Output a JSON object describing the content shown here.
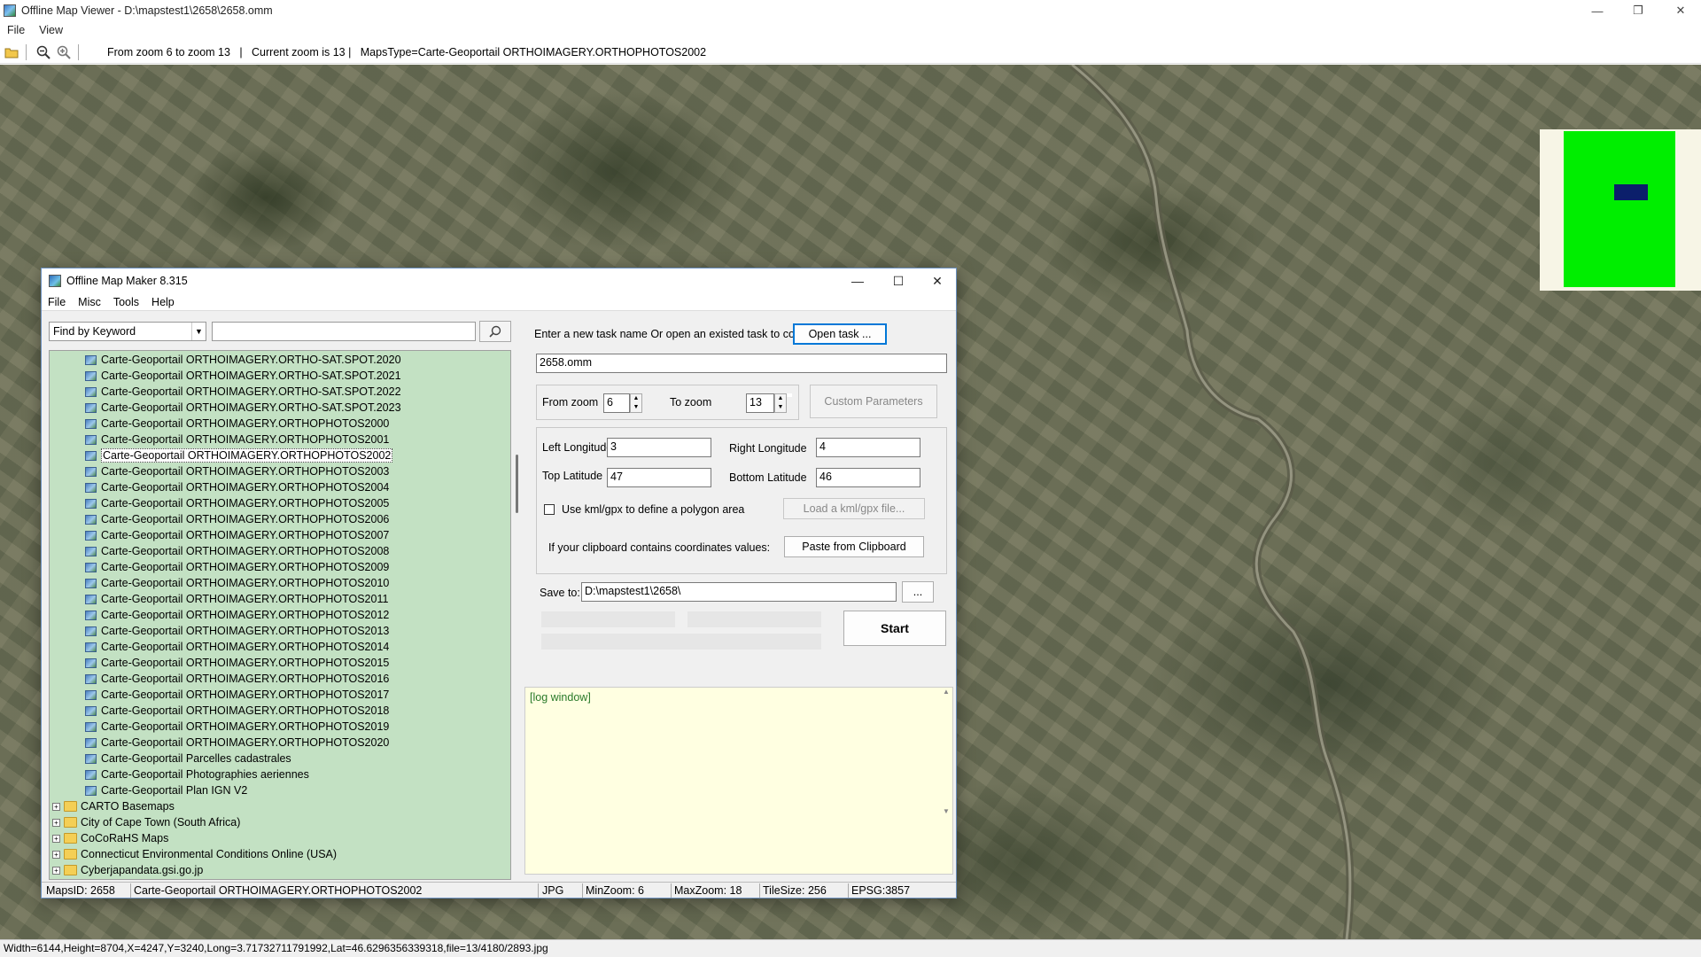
{
  "outer": {
    "title": "Offline Map Viewer - D:\\mapstest1\\2658\\2658.omm",
    "menu": [
      "File",
      "View"
    ],
    "toolbar_text": "From zoom 6 to zoom 13   |   Current zoom is 13 |   MapsType=Carte-Geoportail ORTHOIMAGERY.ORTHOPHOTOS2002",
    "status": "Width=6144,Height=8704,X=4247,Y=3240,Long=3.71732711791992,Lat=46.6296356339318,file=13/4180/2893.jpg"
  },
  "dialog": {
    "title": "Offline Map Maker 8.315",
    "menu": [
      "File",
      "Misc",
      "Tools",
      "Help"
    ],
    "find_select": "Find by Keyword",
    "find_query": "",
    "tree": {
      "maps": [
        "Carte-Geoportail ORTHOIMAGERY.ORTHO-SAT.SPOT.2020",
        "Carte-Geoportail ORTHOIMAGERY.ORTHO-SAT.SPOT.2021",
        "Carte-Geoportail ORTHOIMAGERY.ORTHO-SAT.SPOT.2022",
        "Carte-Geoportail ORTHOIMAGERY.ORTHO-SAT.SPOT.2023",
        "Carte-Geoportail ORTHOIMAGERY.ORTHOPHOTOS2000",
        "Carte-Geoportail ORTHOIMAGERY.ORTHOPHOTOS2001",
        "Carte-Geoportail ORTHOIMAGERY.ORTHOPHOTOS2002",
        "Carte-Geoportail ORTHOIMAGERY.ORTHOPHOTOS2003",
        "Carte-Geoportail ORTHOIMAGERY.ORTHOPHOTOS2004",
        "Carte-Geoportail ORTHOIMAGERY.ORTHOPHOTOS2005",
        "Carte-Geoportail ORTHOIMAGERY.ORTHOPHOTOS2006",
        "Carte-Geoportail ORTHOIMAGERY.ORTHOPHOTOS2007",
        "Carte-Geoportail ORTHOIMAGERY.ORTHOPHOTOS2008",
        "Carte-Geoportail ORTHOIMAGERY.ORTHOPHOTOS2009",
        "Carte-Geoportail ORTHOIMAGERY.ORTHOPHOTOS2010",
        "Carte-Geoportail ORTHOIMAGERY.ORTHOPHOTOS2011",
        "Carte-Geoportail ORTHOIMAGERY.ORTHOPHOTOS2012",
        "Carte-Geoportail ORTHOIMAGERY.ORTHOPHOTOS2013",
        "Carte-Geoportail ORTHOIMAGERY.ORTHOPHOTOS2014",
        "Carte-Geoportail ORTHOIMAGERY.ORTHOPHOTOS2015",
        "Carte-Geoportail ORTHOIMAGERY.ORTHOPHOTOS2016",
        "Carte-Geoportail ORTHOIMAGERY.ORTHOPHOTOS2017",
        "Carte-Geoportail ORTHOIMAGERY.ORTHOPHOTOS2018",
        "Carte-Geoportail ORTHOIMAGERY.ORTHOPHOTOS2019",
        "Carte-Geoportail ORTHOIMAGERY.ORTHOPHOTOS2020",
        "Carte-Geoportail Parcelles cadastrales",
        "Carte-Geoportail Photographies aeriennes",
        "Carte-Geoportail Plan IGN V2"
      ],
      "selected": "Carte-Geoportail ORTHOIMAGERY.ORTHOPHOTOS2002",
      "folders": [
        "CARTO Basemaps",
        "City of Cape Town (South Africa)",
        "CoCoRaHS Maps",
        "Connecticut Environmental Conditions Online (USA)",
        "Cyberjapandata.gsi.go.jp"
      ]
    },
    "task_prompt": "Enter a new task name Or open an existed task to continue:",
    "open_task_label": "Open task ...",
    "task_name": "2658.omm",
    "from_zoom_label": "From zoom",
    "from_zoom": "6",
    "to_zoom_label": "To zoom",
    "to_zoom": "13",
    "custom_params_label": "Custom Parameters",
    "left_lon_label": "Left Longitude",
    "left_lon": "3",
    "right_lon_label": "Right Longitude",
    "right_lon": "4",
    "top_lat_label": "Top Latitude",
    "top_lat": "47",
    "bottom_lat_label": "Bottom Latitude",
    "bottom_lat": "46",
    "kml_label": "Use kml/gpx to define a polygon area",
    "load_kml_label": "Load a kml/gpx file...",
    "clipboard_prompt": "If your clipboard contains coordinates values:",
    "paste_label": "Paste from Clipboard",
    "save_to_label": "Save to:",
    "save_to": "D:\\mapstest1\\2658\\",
    "browse_label": "...",
    "start_label": "Start",
    "log_text": "[log window]",
    "status": {
      "maps_id": "MapsID: 2658",
      "map_name": "Carte-Geoportail ORTHOIMAGERY.ORTHOPHOTOS2002",
      "format": "JPG",
      "min_zoom": "MinZoom: 6",
      "max_zoom": "MaxZoom: 18",
      "tile_size": "TileSize: 256",
      "epsg": "EPSG:3857"
    }
  },
  "colors": {
    "tree_bg": "#c3e1c3",
    "log_bg": "#ffffe1",
    "overview_green": "#00ee00",
    "overview_view": "#0b1f6b"
  }
}
